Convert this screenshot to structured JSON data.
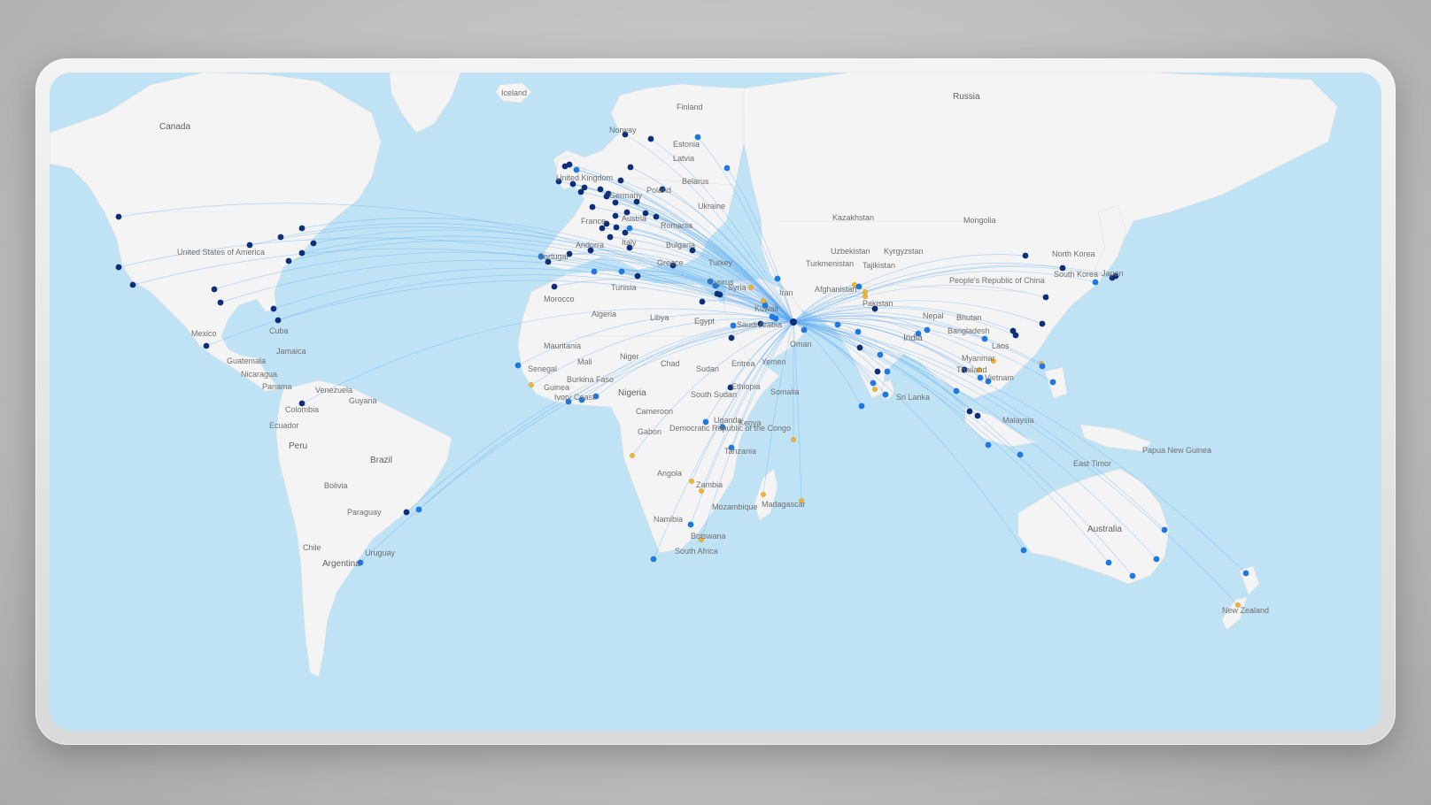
{
  "map": {
    "hub": "hub-dubai",
    "colors": {
      "ocean": "#bfe3f5",
      "land": "#f4f4f4",
      "route": "#5aa9ef",
      "dot_major": "#0d2f7a",
      "dot_standard": "#1f77e0",
      "dot_partner": "#f2b431"
    },
    "labels": {
      "iceland": "Iceland",
      "canada": "Canada",
      "usa": "United States of America",
      "mexico": "Mexico",
      "cuba": "Cuba",
      "jamaica": "Jamaica",
      "guatemala": "Guatemala",
      "nicaragua": "Nicaragua",
      "panama": "Panama",
      "venezuela": "Venezuela",
      "guyana": "Guyana",
      "colombia": "Colombia",
      "ecuador": "Ecuador",
      "peru": "Peru",
      "brazil": "Brazil",
      "bolivia": "Bolivia",
      "paraguay": "Paraguay",
      "chile": "Chile",
      "argentina": "Argentina",
      "uruguay": "Uruguay",
      "norway": "Norway",
      "finland": "Finland",
      "estonia": "Estonia",
      "latvia": "Latvia",
      "belarus": "Belarus",
      "ukraine": "Ukraine",
      "united_kingdom": "United Kingdom",
      "germany": "Germany",
      "poland": "Poland",
      "france": "France",
      "austria": "Austria",
      "italy": "Italy",
      "romania": "Romania",
      "bulgaria": "Bulgaria",
      "greece": "Greece",
      "andorra": "Andorra",
      "portugal": "Portugal",
      "tunisia": "Tunisia",
      "morocco": "Morocco",
      "algeria": "Algeria",
      "libya": "Libya",
      "egypt": "Egypt",
      "turkey": "Turkey",
      "cyprus": "Cyprus",
      "syria": "Syria",
      "iran": "Iran",
      "kuwait": "Kuwait",
      "saudi_arabia": "Saudi Arabia",
      "oman": "Oman",
      "yemen": "Yemen",
      "eritrea": "Eritrea",
      "sudan": "Sudan",
      "south_sudan": "South Sudan",
      "ethiopia": "Ethiopia",
      "somalia": "Somalia",
      "chad": "Chad",
      "niger": "Niger",
      "mali": "Mali",
      "mauritania": "Mauritania",
      "senegal": "Senegal",
      "guinea": "Guinea",
      "burkina_faso": "Burkina Faso",
      "ivory_coast": "Ivory Coast",
      "nigeria": "Nigeria",
      "cameroon": "Cameroon",
      "gabon": "Gabon",
      "drc": "Democratic Republic of the Congo",
      "uganda": "Uganda",
      "kenya": "Kenya",
      "tanzania": "Tanzania",
      "angola": "Angola",
      "zambia": "Zambia",
      "mozambique": "Mozambique",
      "namibia": "Namibia",
      "botswana": "Botswana",
      "south_africa": "South Africa",
      "madagascar": "Madagascar",
      "russia": "Russia",
      "kazakhstan": "Kazakhstan",
      "uzbekistan": "Uzbekistan",
      "kyrgyzstan": "Kyrgyzstan",
      "turkmenistan": "Turkmenistan",
      "tajikistan": "Tajikistan",
      "afghanistan": "Afghanistan",
      "pakistan": "Pakistan",
      "nepal": "Nepal",
      "bhutan": "Bhutan",
      "india": "India",
      "bangladesh": "Bangladesh",
      "myanmar": "Myanmar",
      "sri_lanka": "Sri Lanka",
      "mongolia": "Mongolia",
      "china": "People's Republic of China",
      "north_korea": "North Korea",
      "south_korea": "South Korea",
      "japan": "Japan",
      "laos": "Laos",
      "thailand": "Thailand",
      "vietnam": "Vietnam",
      "malaysia": "Malaysia",
      "papua_new_guinea": "Papua New Guinea",
      "east_timor": "East Timor",
      "australia": "Australia",
      "new_zealand": "New Zealand"
    }
  }
}
